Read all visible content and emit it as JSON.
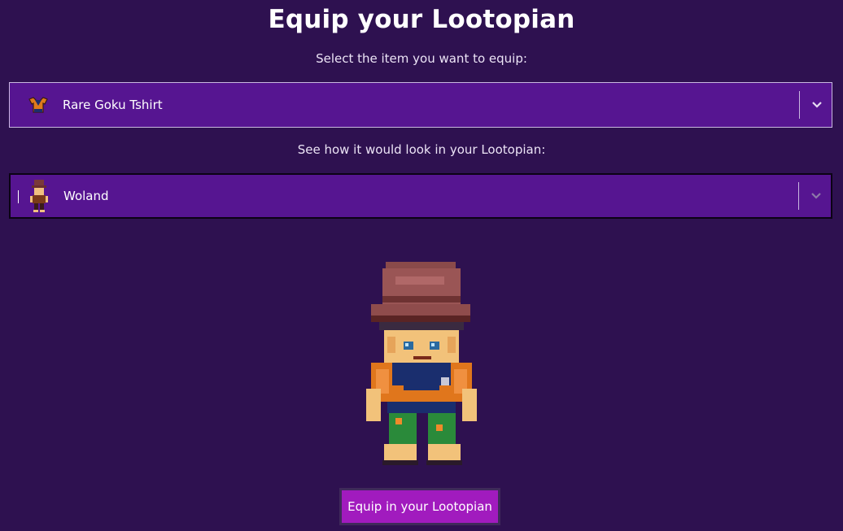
{
  "page": {
    "title": "Equip your Lootopian",
    "item_prompt": "Select the item you want to equip:",
    "preview_prompt": "See how it would look in your Lootopian:"
  },
  "item_select": {
    "value": "Rare Goku Tshirt",
    "thumbnail_icon": "tshirt-icon",
    "indicator_icon": "chevron-down-icon"
  },
  "character_select": {
    "value": "Woland",
    "thumbnail_icon": "character-avatar",
    "indicator_icon": "chevron-down-icon"
  },
  "preview": {
    "sprite": "character-sprite-with-goku-tshirt"
  },
  "actions": {
    "equip_label": "Equip in your Lootopian"
  },
  "colors": {
    "background": "#2e1150",
    "select_bg": "#561591",
    "button_bg": "#a11bbe"
  }
}
